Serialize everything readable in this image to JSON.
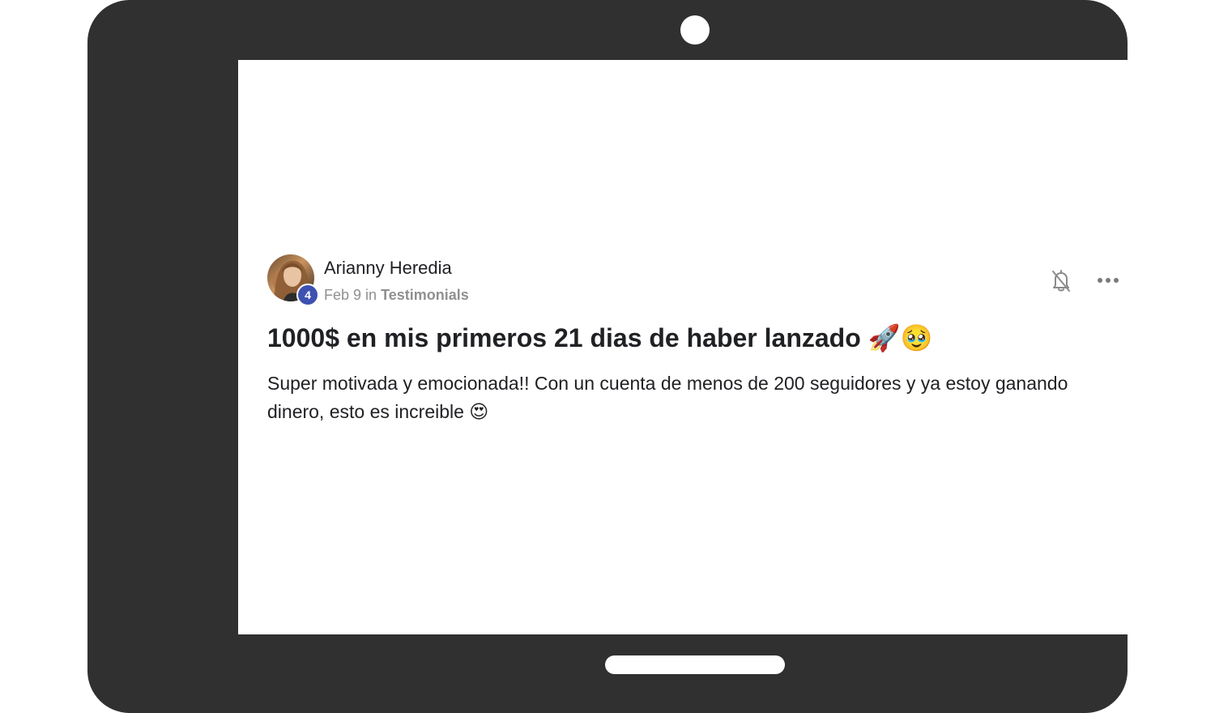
{
  "post": {
    "author": "Arianny Heredia",
    "level": "4",
    "date": "Feb 9",
    "in_word": "in",
    "category": "Testimonials",
    "title": "1000$ en mis primeros 21 dias de haber lanzado 🚀🥹",
    "body": "Super motivada y emocionada!! Con un cuenta de menos de 200 seguidores y ya estoy ganando dinero, esto es increible 😍"
  },
  "icons": {
    "notify": "bell-off-icon",
    "menu": "more-horizontal-icon"
  },
  "colors": {
    "device_frame": "#303030",
    "badge": "#3d51b0",
    "meta_text": "#909090",
    "text": "#202124"
  }
}
